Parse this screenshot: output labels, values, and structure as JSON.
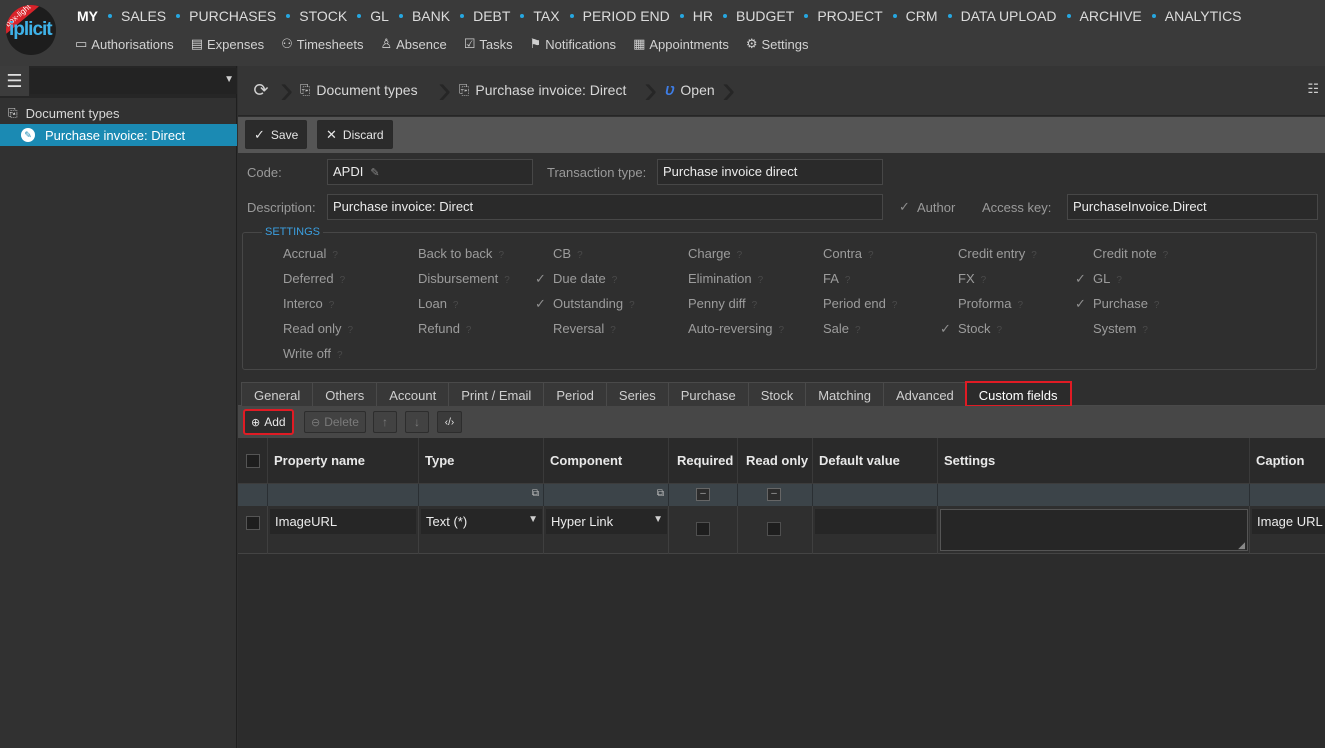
{
  "app": {
    "logo_text": "iplicit",
    "ribbon_text": "box-light"
  },
  "main_nav": [
    "MY",
    "SALES",
    "PURCHASES",
    "STOCK",
    "GL",
    "BANK",
    "DEBT",
    "TAX",
    "PERIOD END",
    "HR",
    "BUDGET",
    "PROJECT",
    "CRM",
    "DATA UPLOAD",
    "ARCHIVE",
    "ANALYTICS"
  ],
  "sub_nav": [
    {
      "label": "Authorisations",
      "icon": "authorisations-icon"
    },
    {
      "label": "Expenses",
      "icon": "expenses-icon"
    },
    {
      "label": "Timesheets",
      "icon": "timesheets-icon"
    },
    {
      "label": "Absence",
      "icon": "absence-icon"
    },
    {
      "label": "Tasks",
      "icon": "tasks-icon"
    },
    {
      "label": "Notifications",
      "icon": "flag-icon"
    },
    {
      "label": "Appointments",
      "icon": "calendar-icon"
    },
    {
      "label": "Settings",
      "icon": "gear-icon"
    }
  ],
  "tree": {
    "root": "Document types",
    "child": "Purchase invoice: Direct"
  },
  "breadcrumb": {
    "items": [
      "Document types",
      "Purchase invoice: Direct",
      "Open"
    ]
  },
  "toolbar": {
    "save": "Save",
    "discard": "Discard"
  },
  "form": {
    "code_label": "Code:",
    "code_value": "APDI",
    "transaction_type_label": "Transaction type:",
    "transaction_type_value": "Purchase invoice direct",
    "description_label": "Description:",
    "description_value": "Purchase invoice: Direct",
    "author_label": "Author",
    "access_key_label": "Access key:",
    "access_key_value": "PurchaseInvoice.Direct"
  },
  "settings": {
    "legend": "SETTINGS",
    "flags": [
      {
        "label": "Accrual",
        "checked": false
      },
      {
        "label": "Back to back",
        "checked": false
      },
      {
        "label": "CB",
        "checked": false
      },
      {
        "label": "Charge",
        "checked": false
      },
      {
        "label": "Contra",
        "checked": false
      },
      {
        "label": "Credit entry",
        "checked": false
      },
      {
        "label": "Credit note",
        "checked": false
      },
      {
        "label": "Deferred",
        "checked": false
      },
      {
        "label": "Disbursement",
        "checked": false
      },
      {
        "label": "Due date",
        "checked": true
      },
      {
        "label": "Elimination",
        "checked": false
      },
      {
        "label": "FA",
        "checked": false
      },
      {
        "label": "FX",
        "checked": false
      },
      {
        "label": "GL",
        "checked": true
      },
      {
        "label": "Interco",
        "checked": false
      },
      {
        "label": "Loan",
        "checked": false
      },
      {
        "label": "Outstanding",
        "checked": true
      },
      {
        "label": "Penny diff",
        "checked": false
      },
      {
        "label": "Period end",
        "checked": false
      },
      {
        "label": "Proforma",
        "checked": false
      },
      {
        "label": "Purchase",
        "checked": true
      },
      {
        "label": "Read only",
        "checked": false
      },
      {
        "label": "Refund",
        "checked": false
      },
      {
        "label": "Reversal",
        "checked": false
      },
      {
        "label": "Auto-reversing",
        "checked": false
      },
      {
        "label": "Sale",
        "checked": false
      },
      {
        "label": "Stock",
        "checked": true
      },
      {
        "label": "System",
        "checked": false
      },
      {
        "label": "Write off",
        "checked": false
      }
    ]
  },
  "tabs": [
    "General",
    "Others",
    "Account",
    "Print / Email",
    "Period",
    "Series",
    "Purchase",
    "Stock",
    "Matching",
    "Advanced",
    "Custom fields"
  ],
  "active_tab": "Custom fields",
  "grid_toolbar": {
    "add": "Add",
    "delete": "Delete"
  },
  "grid": {
    "columns": [
      "Property name",
      "Type",
      "Component",
      "Required",
      "Read only",
      "Default value",
      "Settings",
      "Caption"
    ],
    "rows": [
      {
        "property_name": "ImageURL",
        "type": "Text (*)",
        "component": "Hyper Link",
        "required": false,
        "read_only": false,
        "default_value": "",
        "settings": "",
        "caption": "Image URL"
      }
    ]
  },
  "colors": {
    "accent": "#1b8ab3",
    "highlight": "#e01b24",
    "nav_dot": "#26a7e0"
  }
}
